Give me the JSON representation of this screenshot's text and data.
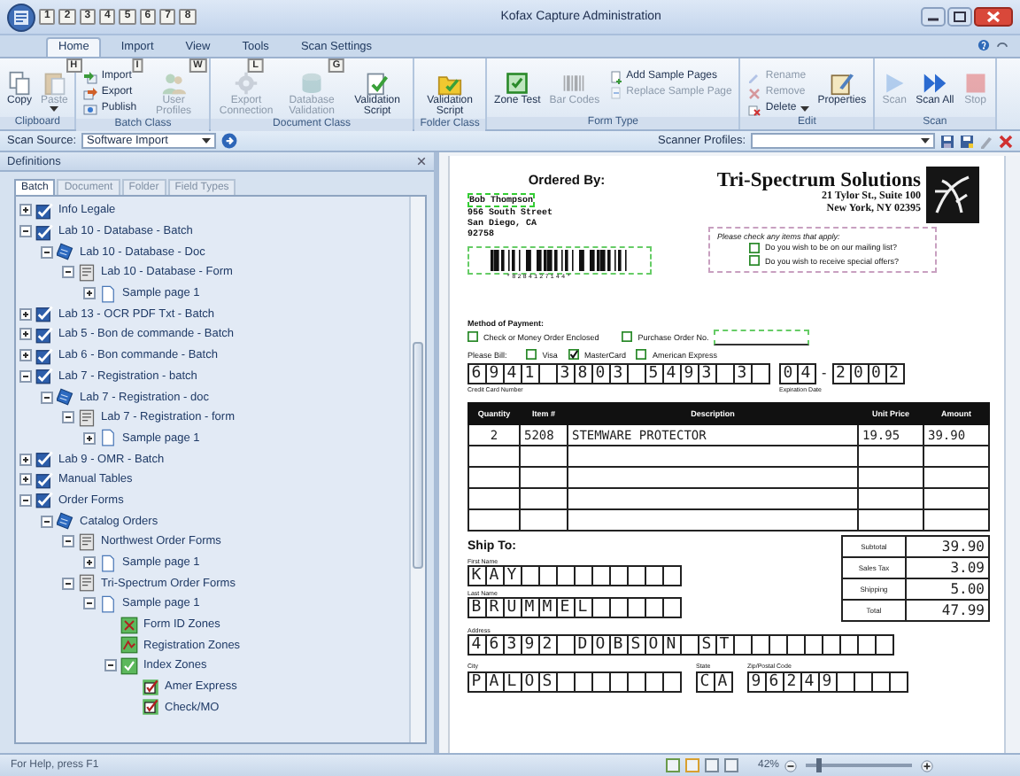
{
  "window": {
    "title": "Kofax Capture Administration"
  },
  "quick_access": {
    "key_tips": [
      "1",
      "2",
      "3",
      "4",
      "5",
      "6",
      "7",
      "8"
    ]
  },
  "ribbon": {
    "tabs": [
      {
        "label": "Home",
        "key_tip": "H",
        "selected": true
      },
      {
        "label": "Import",
        "key_tip": "I",
        "selected": false
      },
      {
        "label": "View",
        "key_tip": "W",
        "selected": false
      },
      {
        "label": "Tools",
        "key_tip": "L",
        "selected": false
      },
      {
        "label": "Scan Settings",
        "key_tip": "G",
        "selected": false
      }
    ],
    "groups": [
      {
        "label": "Clipboard",
        "items": [
          {
            "kind": "large",
            "label": "Copy",
            "disabled": false
          },
          {
            "kind": "large",
            "label": "Paste",
            "disabled": true,
            "dropdown": true
          }
        ]
      },
      {
        "label": "Batch Class",
        "items": [
          {
            "kind": "small",
            "label": "Import",
            "disabled": false
          },
          {
            "kind": "small",
            "label": "Export",
            "disabled": false
          },
          {
            "kind": "small",
            "label": "Publish",
            "disabled": false
          },
          {
            "kind": "large",
            "label": "User Profiles",
            "disabled": true
          }
        ]
      },
      {
        "label": "Document Class",
        "items": [
          {
            "kind": "large",
            "label": "Export Connection",
            "disabled": true
          },
          {
            "kind": "large",
            "label": "Database Validation",
            "disabled": true
          },
          {
            "kind": "large",
            "label": "Validation Script",
            "disabled": false
          }
        ]
      },
      {
        "label": "Folder Class",
        "items": [
          {
            "kind": "large",
            "label": "Validation Script",
            "disabled": false
          }
        ]
      },
      {
        "label": "Form Type",
        "items": [
          {
            "kind": "large",
            "label": "Zone Test",
            "disabled": false
          },
          {
            "kind": "large",
            "label": "Bar Codes",
            "disabled": true
          },
          {
            "kind": "small",
            "label": "Add Sample Pages",
            "disabled": false
          },
          {
            "kind": "small",
            "label": "Replace Sample Page",
            "disabled": true
          }
        ]
      },
      {
        "label": "Edit",
        "items": [
          {
            "kind": "small",
            "label": "Rename",
            "disabled": true
          },
          {
            "kind": "small",
            "label": "Remove",
            "disabled": true
          },
          {
            "kind": "small",
            "label": "Delete",
            "disabled": false,
            "dropdown": true
          },
          {
            "kind": "large",
            "label": "Properties",
            "disabled": false
          }
        ]
      },
      {
        "label": "Scan",
        "items": [
          {
            "kind": "large",
            "label": "Scan",
            "disabled": true
          },
          {
            "kind": "large",
            "label": "Scan All",
            "disabled": false
          },
          {
            "kind": "large",
            "label": "Stop",
            "disabled": true
          }
        ]
      }
    ]
  },
  "scan_bar": {
    "scan_source": {
      "label": "Scan Source:",
      "value": "Software Import"
    },
    "scanner_profiles": {
      "label": "Scanner Profiles:"
    }
  },
  "definitions": {
    "title": "Definitions",
    "tabs": [
      {
        "label": "Batch",
        "selected": true
      },
      {
        "label": "Document",
        "selected": false
      },
      {
        "label": "Folder",
        "selected": false
      },
      {
        "label": "Field Types",
        "selected": false
      }
    ],
    "tree": [
      {
        "kind": "batch",
        "label": "Info Legale",
        "expanded": false
      },
      {
        "kind": "batch",
        "label": "Lab 10 - Database - Batch",
        "expanded": true,
        "children": [
          {
            "kind": "document",
            "label": "Lab 10 - Database - Doc",
            "expanded": true,
            "children": [
              {
                "kind": "form",
                "label": "Lab 10 - Database - Form",
                "expanded": true,
                "children": [
                  {
                    "kind": "page",
                    "label": "Sample page 1",
                    "expanded": false
                  }
                ]
              }
            ]
          }
        ]
      },
      {
        "kind": "batch",
        "label": "Lab 13 - OCR PDF Txt - Batch",
        "expanded": false
      },
      {
        "kind": "batch",
        "label": "Lab 5 - Bon de commande - Batch",
        "expanded": false
      },
      {
        "kind": "batch",
        "label": "Lab 6 - Bon commande - Batch",
        "expanded": false
      },
      {
        "kind": "batch",
        "label": "Lab 7 - Registration - batch",
        "expanded": true,
        "children": [
          {
            "kind": "document",
            "label": "Lab 7 - Registration - doc",
            "expanded": true,
            "children": [
              {
                "kind": "form",
                "label": "Lab 7 - Registration - form",
                "expanded": true,
                "children": [
                  {
                    "kind": "page",
                    "label": "Sample page 1",
                    "expanded": false
                  }
                ]
              }
            ]
          }
        ]
      },
      {
        "kind": "batch",
        "label": "Lab 9 - OMR - Batch",
        "expanded": false
      },
      {
        "kind": "batch",
        "label": "Manual Tables",
        "expanded": false
      },
      {
        "kind": "batch",
        "label": "Order Forms",
        "expanded": true,
        "children": [
          {
            "kind": "document",
            "label": "Catalog Orders",
            "expanded": true,
            "children": [
              {
                "kind": "form",
                "label": "Northwest Order Forms",
                "expanded": true,
                "children": [
                  {
                    "kind": "page",
                    "label": "Sample page 1",
                    "expanded": false
                  }
                ]
              },
              {
                "kind": "form",
                "label": "Tri-Spectrum Order Forms",
                "expanded": true,
                "children": [
                  {
                    "kind": "page",
                    "label": "Sample page 1",
                    "expanded": true,
                    "children": [
                      {
                        "kind": "form-id-zone",
                        "label": "Form ID Zones"
                      },
                      {
                        "kind": "registration-zone",
                        "label": "Registration Zones"
                      },
                      {
                        "kind": "index-zone",
                        "label": "Index Zones",
                        "expanded": true,
                        "children": [
                          {
                            "kind": "field",
                            "label": "Amer Express"
                          },
                          {
                            "kind": "field",
                            "label": "Check/MO"
                          }
                        ]
                      }
                    ]
                  }
                ]
              }
            ]
          }
        ]
      }
    ]
  },
  "document": {
    "ordered_by": {
      "heading": "Ordered By:",
      "lines": [
        "Bob Thompson",
        "956 South Street",
        "San Diego, CA",
        "92758"
      ],
      "barcode_digits": "*8284127144*"
    },
    "company": {
      "name": "Tri-Spectrum Solutions",
      "address": [
        "21 Tylor St., Suite 100",
        "New York, NY  02395"
      ]
    },
    "options": {
      "heading": "Please check any items that apply:",
      "items": [
        {
          "label": "Do you wish to be on our mailing list?",
          "checked": false
        },
        {
          "label": "Do you wish to receive special offers?",
          "checked": false
        }
      ]
    },
    "payment": {
      "heading": "Method of Payment:",
      "methods": [
        {
          "label": "Check or Money Order Enclosed",
          "checked": false
        },
        {
          "label": "Purchase Order No.",
          "checked": false
        }
      ],
      "bill_label": "Please Bill:",
      "cards": [
        {
          "label": "Visa",
          "checked": false
        },
        {
          "label": "MasterCard",
          "checked": true
        },
        {
          "label": "American Express",
          "checked": false
        }
      ],
      "card_number": "6941 3803 5493 3",
      "card_number_label": "Credit Card Number",
      "expiration_month": "04",
      "expiration_separator": "-",
      "expiration_year": "2002",
      "expiration_label": "Expiration Date"
    },
    "order_table": {
      "columns": [
        "Quantity",
        "Item #",
        "Description",
        "Unit Price",
        "Amount"
      ],
      "rows": [
        [
          "2",
          "5208",
          "STEMWARE PROTECTOR",
          "19.95",
          "39.90"
        ]
      ]
    },
    "totals": [
      {
        "label": "Subtotal",
        "value": "39.90"
      },
      {
        "label": "Sales Tax",
        "value": "3.09"
      },
      {
        "label": "Shipping",
        "value": "5.00"
      },
      {
        "label": "Total",
        "value": "47.99"
      }
    ],
    "ship_to": {
      "heading": "Ship To:",
      "first_name": {
        "label": "First Name",
        "value": "KAY"
      },
      "last_name": {
        "label": "Last Name",
        "value": "BRUMMEL"
      },
      "address": {
        "label": "Address",
        "value": "46392 DOBSON ST"
      },
      "city": {
        "label": "City",
        "value": "PALOS"
      },
      "state": {
        "label": "State",
        "value": "CA"
      },
      "zip": {
        "label": "Zip/Postal Code",
        "value": "96249"
      }
    }
  },
  "status_bar": {
    "text": "For Help, press F1",
    "zoom": "42%",
    "zoom_slider": {
      "level": 0.12
    }
  }
}
